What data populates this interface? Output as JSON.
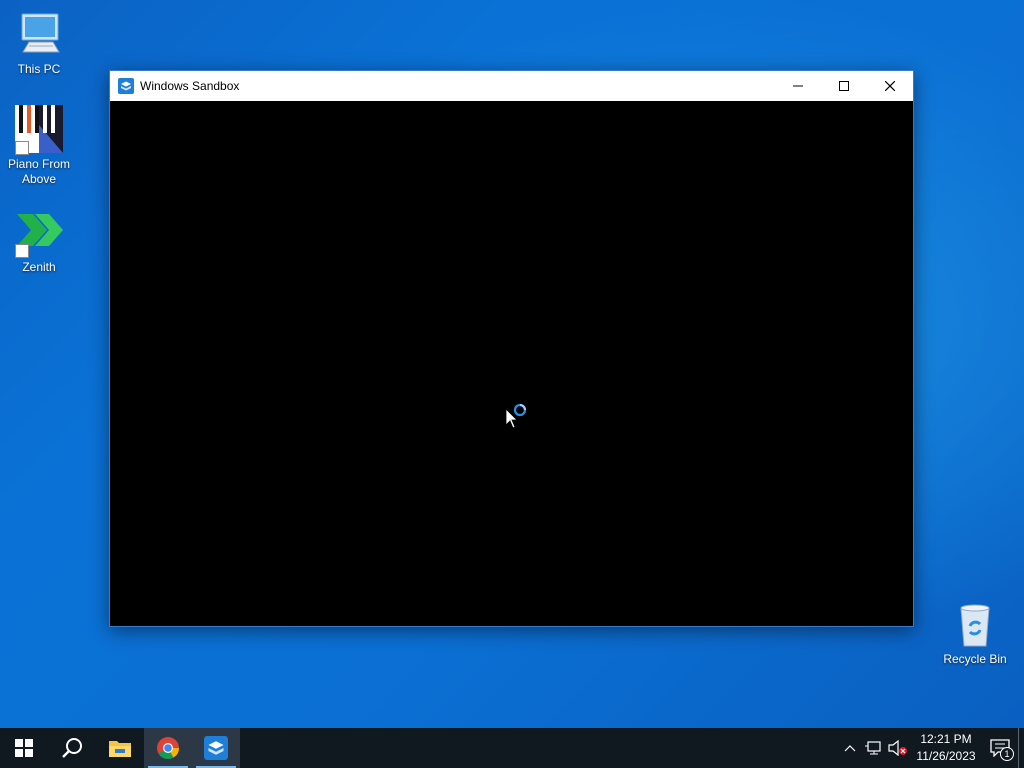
{
  "desktop": {
    "icons": [
      {
        "label": "This PC"
      },
      {
        "label": "Piano From Above"
      },
      {
        "label": "Zenith"
      },
      {
        "label": "Recycle Bin"
      }
    ]
  },
  "window": {
    "title": "Windows Sandbox"
  },
  "taskbar": {
    "apps": [
      "start",
      "search",
      "file-explorer",
      "chrome",
      "windows-sandbox"
    ]
  },
  "tray": {
    "time": "12:21 PM",
    "date": "11/26/2023",
    "notification_count": "1"
  },
  "colors": {
    "accent": "#0a6fd3",
    "taskbar": "#101820",
    "window_client": "#000000"
  }
}
